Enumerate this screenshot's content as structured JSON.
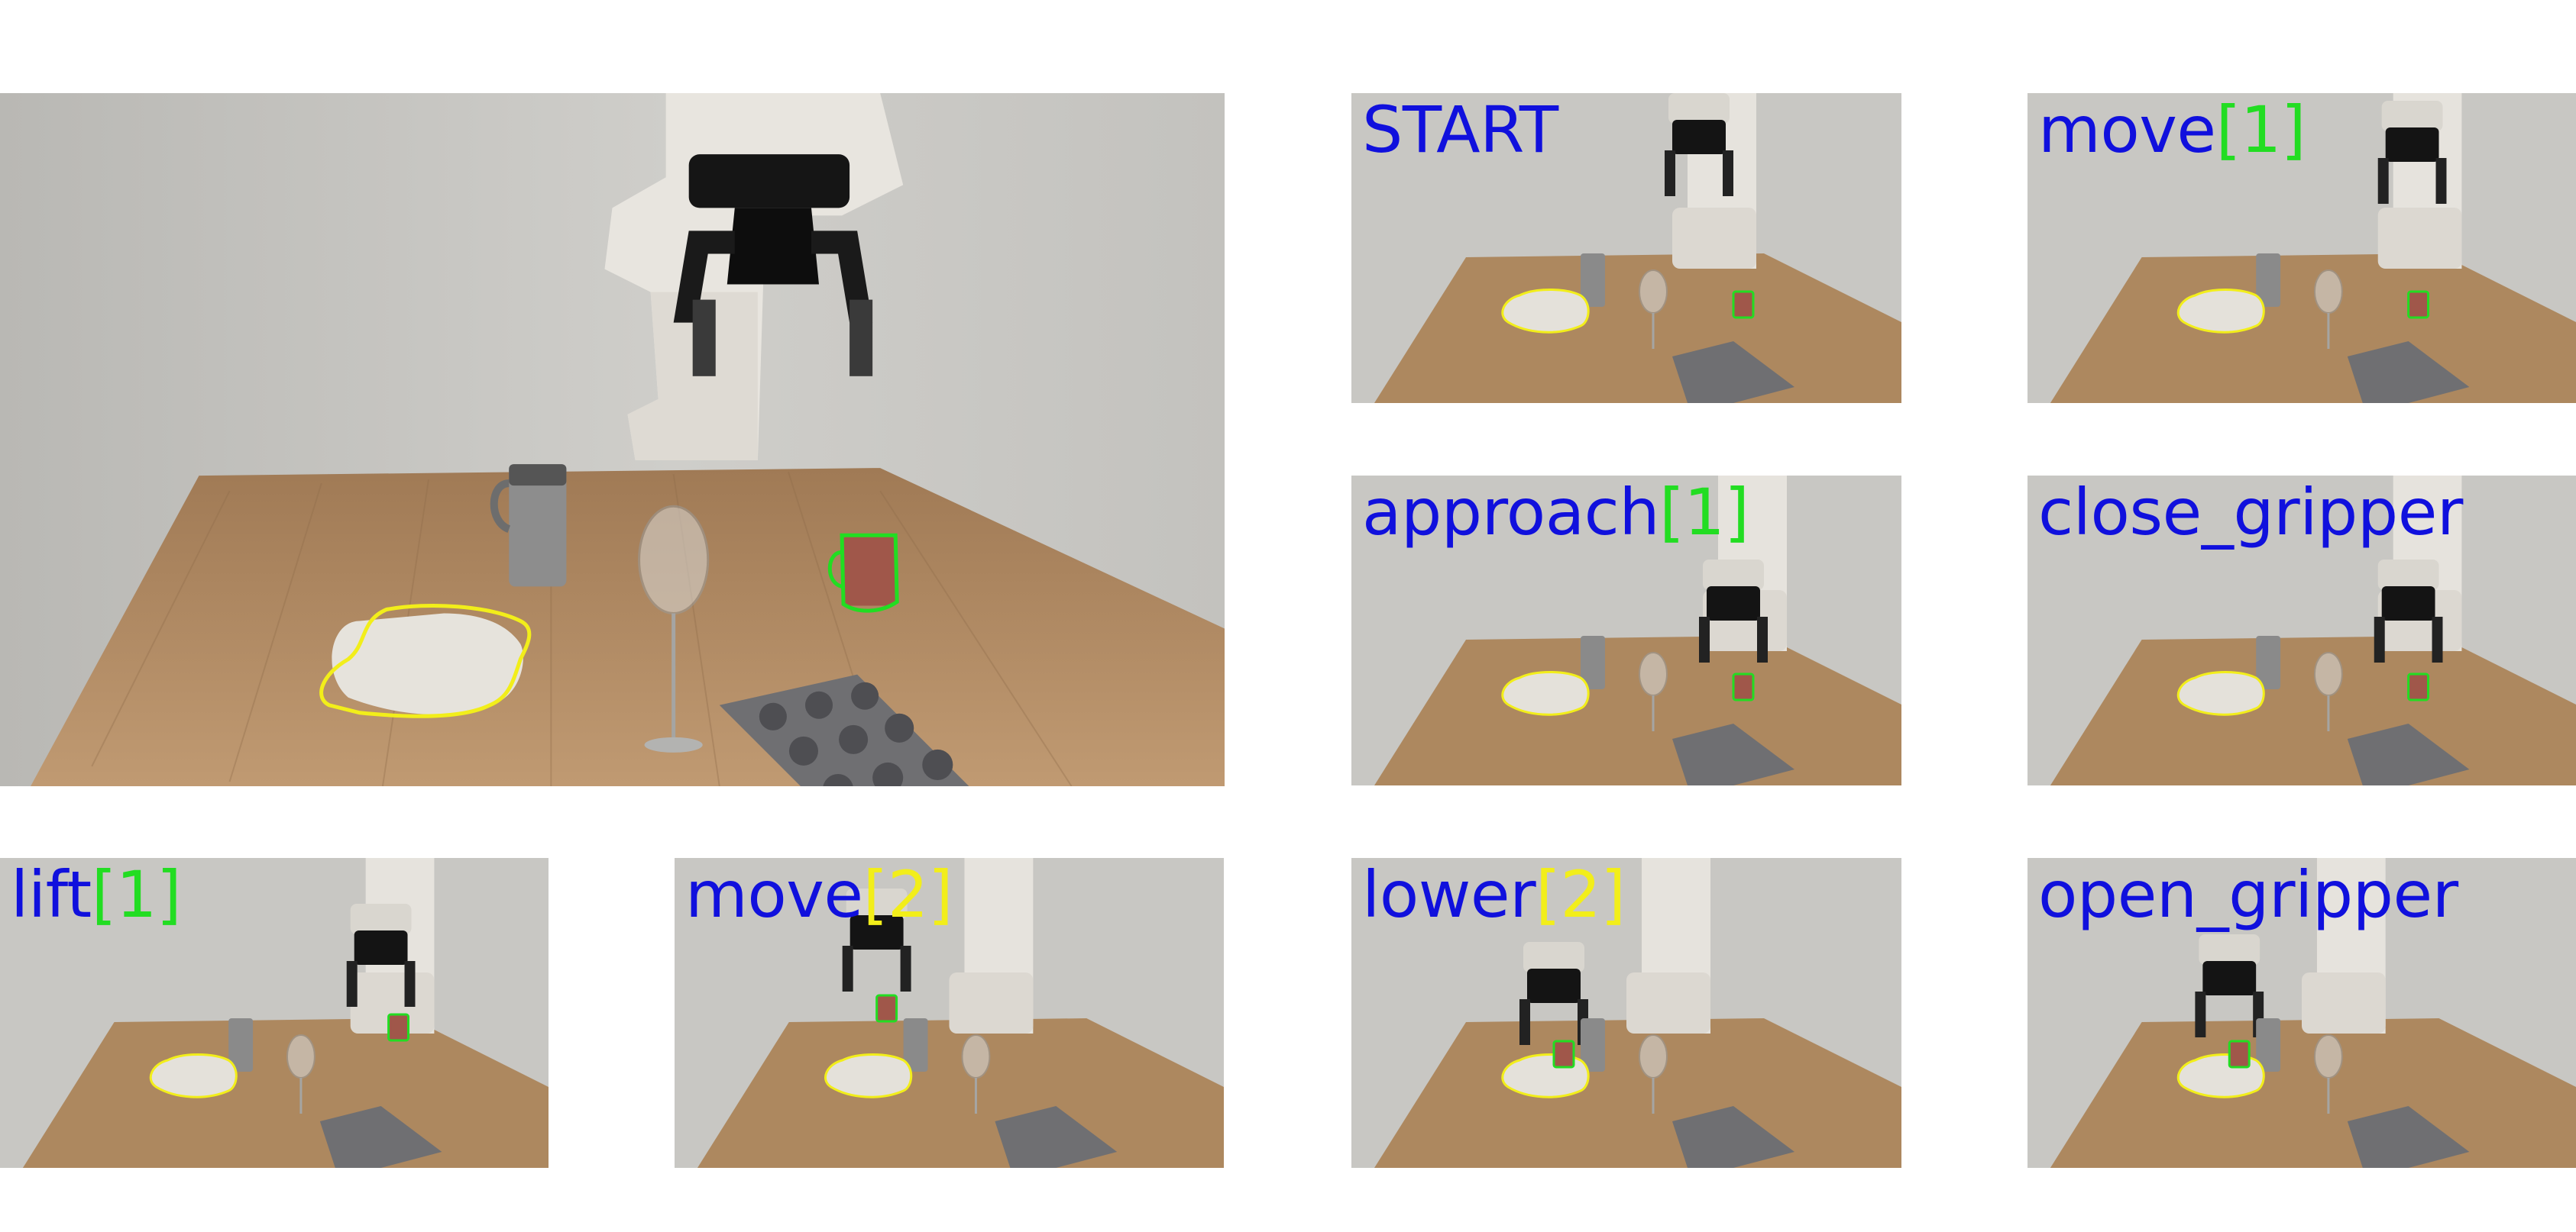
{
  "colors": {
    "label_verb": "#1010dd",
    "label_arg_green": "#22dd22",
    "label_arg_yellow": "#f2ee1a",
    "outline_tray": "#f2ee1a",
    "outline_mug": "#22dd22",
    "wall": "#c9c8c4",
    "table": "#b08a63"
  },
  "main_view": {
    "objects": [
      "foam-tray",
      "travel-mug",
      "wine-glass",
      "red-mug",
      "muffin-tin",
      "robot-gripper"
    ]
  },
  "steps": [
    {
      "id": "start",
      "verb": "START",
      "arg": "",
      "arg_color": ""
    },
    {
      "id": "move1",
      "verb": "move",
      "arg": "[1]",
      "arg_color": "green"
    },
    {
      "id": "approach",
      "verb": "approach",
      "arg": "[1]",
      "arg_color": "green"
    },
    {
      "id": "close",
      "verb": "close_gripper",
      "arg": "",
      "arg_color": ""
    },
    {
      "id": "lift",
      "verb": "lift",
      "arg": "[1]",
      "arg_color": "green"
    },
    {
      "id": "move2",
      "verb": "move",
      "arg": "[2]",
      "arg_color": "yellow"
    },
    {
      "id": "lower",
      "verb": "lower",
      "arg": "[2]",
      "arg_color": "yellow"
    },
    {
      "id": "open",
      "verb": "open_gripper",
      "arg": "",
      "arg_color": ""
    }
  ]
}
